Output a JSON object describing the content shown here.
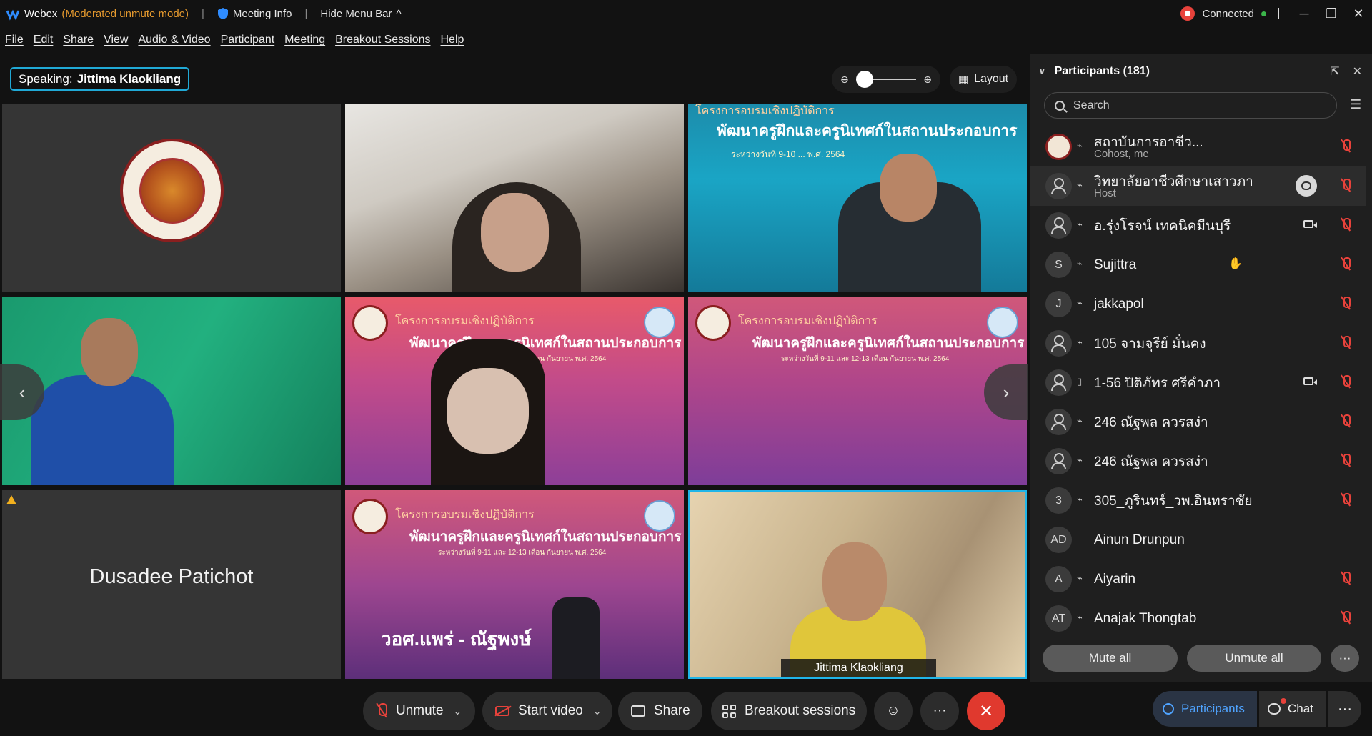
{
  "titlebar": {
    "app": "Webex",
    "mode": "(Moderated unmute mode)",
    "meeting_info": "Meeting Info",
    "hide_menu": "Hide Menu Bar",
    "status": "Connected"
  },
  "menu": [
    "File",
    "Edit",
    "Share",
    "View",
    "Audio & Video",
    "Participant",
    "Meeting",
    "Breakout Sessions",
    "Help"
  ],
  "speaking": {
    "label": "Speaking:",
    "name": "Jittima Klaokliang"
  },
  "layout_button": "Layout",
  "tiles": {
    "t3_title": "โครงการอบรมเชิงปฏิบัติการ",
    "t3_sub": "พัฒนาครูฝึกและครูนิเทศก์ในสถานประกอบการ",
    "t3_small": "ระหว่างวันที่ 9-10 ... พ.ศ. 2564",
    "banner_title": "โครงการอบรมเชิงปฏิบัติการ",
    "banner_sub": "พัฒนาครูฝึกและครูนิเทศก์ในสถานประกอบการ",
    "banner_small": "ระหว่างวันที่ 9-11 และ 12-13 เดือน กันยายน พ.ศ. 2564",
    "t7_name": "Dusadee Patichot",
    "t8_caption": "วอศ.แพร่ - ณัฐพงษ์",
    "t9_name": "Jittima Klaokliang"
  },
  "participants": {
    "title": "Participants (181)",
    "search_placeholder": "Search",
    "rows": [
      {
        "name": "สถาบันการอาชีว...",
        "role": "Cohost, me",
        "avatar": ""
      },
      {
        "name": "วิทยาลัยอาชีวศึกษาเสาวภา",
        "role": "Host",
        "avatar": ""
      },
      {
        "name": "อ.รุ่งโรจน์ เทคนิคมีนบุรี",
        "role": "",
        "avatar": ""
      },
      {
        "name": "Sujittra",
        "role": "",
        "avatar": "S"
      },
      {
        "name": "jakkapol",
        "role": "",
        "avatar": "J"
      },
      {
        "name": "105 จามจุรีย์ มั่นคง",
        "role": "",
        "avatar": ""
      },
      {
        "name": "1-56 ปิติภัทร ศรีคำภา",
        "role": "",
        "avatar": ""
      },
      {
        "name": "246 ณัฐพล ควรสง่า",
        "role": "",
        "avatar": ""
      },
      {
        "name": "246 ณัฐพล ควรสง่า",
        "role": "",
        "avatar": ""
      },
      {
        "name": "305_ภูรินทร์_วพ.อินทราชัย",
        "role": "",
        "avatar": "3"
      },
      {
        "name": "Ainun Drunpun",
        "role": "",
        "avatar": "AD"
      },
      {
        "name": "Aiyarin",
        "role": "",
        "avatar": "A"
      },
      {
        "name": "Anajak Thongtab",
        "role": "",
        "avatar": "AT"
      }
    ],
    "mute_all": "Mute all",
    "unmute_all": "Unmute all"
  },
  "controls": {
    "unmute": "Unmute",
    "start_video": "Start video",
    "share": "Share",
    "breakout": "Breakout sessions",
    "participants": "Participants",
    "chat": "Chat"
  },
  "colors": {
    "accent": "#20a9d6",
    "leave": "#e0392e",
    "muted": "#e8423b",
    "mode": "#e69a2e"
  }
}
